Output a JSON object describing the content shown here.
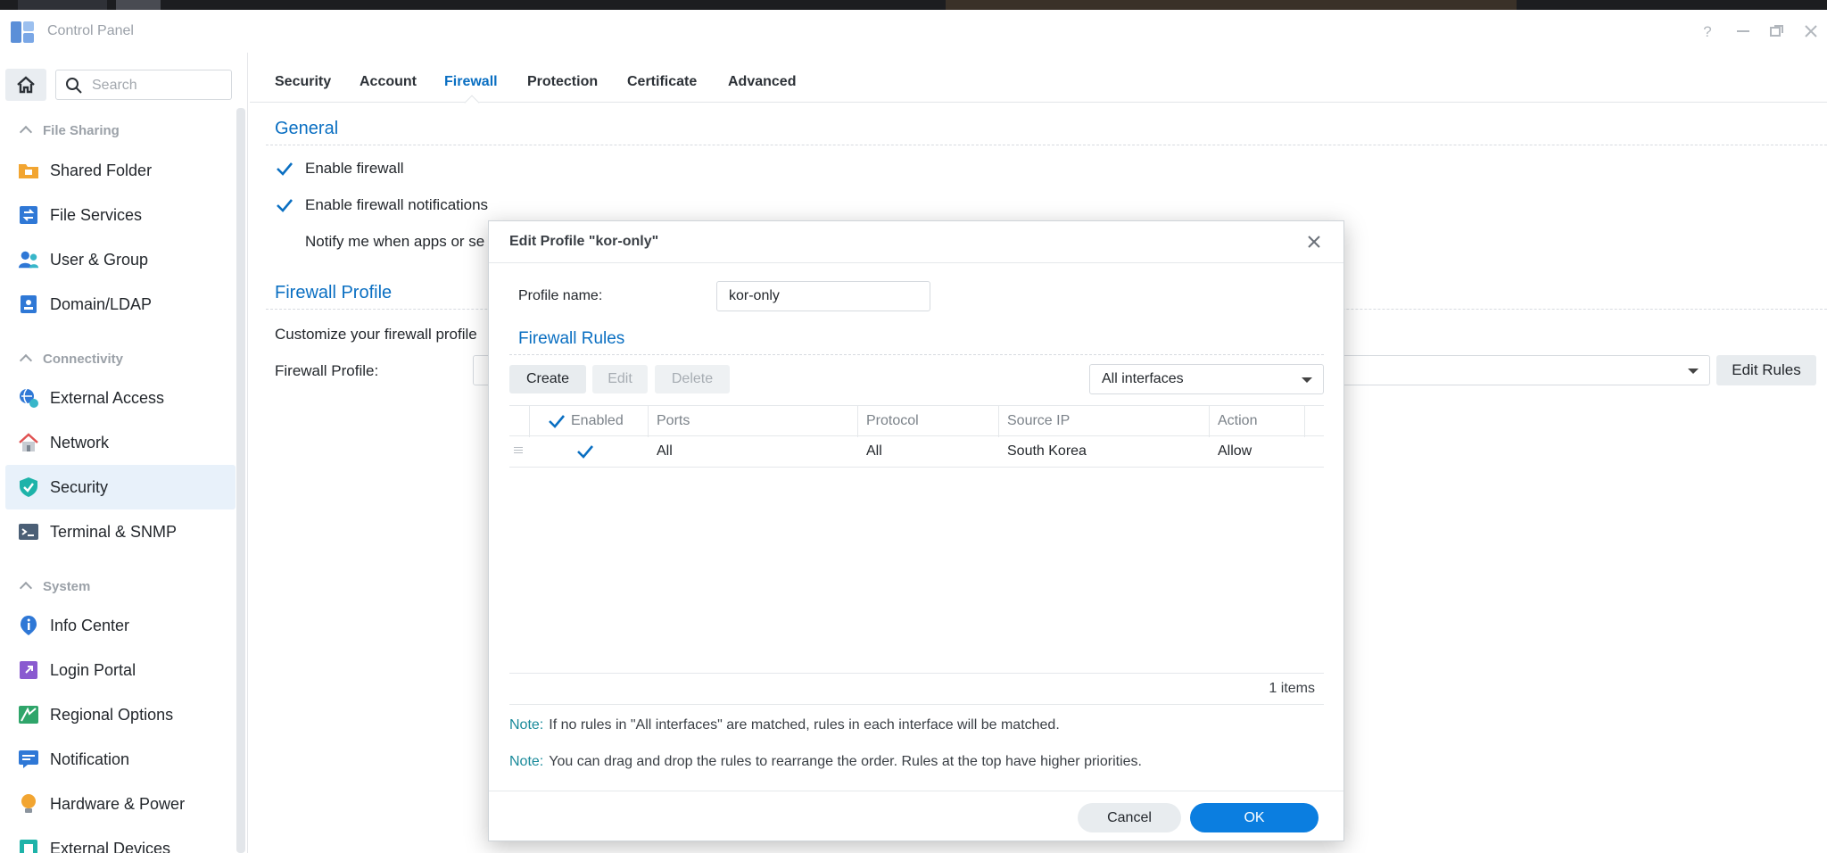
{
  "window": {
    "title": "Control Panel"
  },
  "sidebar": {
    "search_placeholder": "Search",
    "sections": [
      {
        "label": "File Sharing"
      },
      {
        "label": "Connectivity"
      },
      {
        "label": "System"
      }
    ],
    "items": [
      {
        "label": "Shared Folder",
        "icon": "shared-folder-icon"
      },
      {
        "label": "File Services",
        "icon": "file-services-icon"
      },
      {
        "label": "User & Group",
        "icon": "user-group-icon"
      },
      {
        "label": "Domain/LDAP",
        "icon": "domain-ldap-icon"
      },
      {
        "label": "External Access",
        "icon": "external-access-icon"
      },
      {
        "label": "Network",
        "icon": "network-icon"
      },
      {
        "label": "Security",
        "icon": "security-icon",
        "active": true
      },
      {
        "label": "Terminal & SNMP",
        "icon": "terminal-icon"
      },
      {
        "label": "Info Center",
        "icon": "info-center-icon"
      },
      {
        "label": "Login Portal",
        "icon": "login-portal-icon"
      },
      {
        "label": "Regional Options",
        "icon": "regional-options-icon"
      },
      {
        "label": "Notification",
        "icon": "notification-icon"
      },
      {
        "label": "Hardware & Power",
        "icon": "hardware-power-icon"
      },
      {
        "label": "External Devices",
        "icon": "external-devices-icon"
      }
    ]
  },
  "tabs": [
    {
      "label": "Security"
    },
    {
      "label": "Account"
    },
    {
      "label": "Firewall",
      "active": true
    },
    {
      "label": "Protection"
    },
    {
      "label": "Certificate"
    },
    {
      "label": "Advanced"
    }
  ],
  "general": {
    "title": "General",
    "enable_firewall": "Enable firewall",
    "enable_notifications": "Enable firewall notifications",
    "notify_text": "Notify me when apps or se"
  },
  "firewall_profile": {
    "title": "Firewall Profile",
    "description": "Customize your firewall profile",
    "label": "Firewall Profile:",
    "edit_rules": "Edit Rules"
  },
  "dialog": {
    "title": "Edit Profile \"kor-only\"",
    "profile_name_label": "Profile name:",
    "profile_name_value": "kor-only",
    "rules_title": "Firewall Rules",
    "buttons": {
      "create": "Create",
      "edit": "Edit",
      "delete": "Delete"
    },
    "interface_select": "All interfaces",
    "columns": {
      "enabled": "Enabled",
      "ports": "Ports",
      "protocol": "Protocol",
      "source_ip": "Source IP",
      "action": "Action"
    },
    "rows": [
      {
        "enabled": true,
        "ports": "All",
        "protocol": "All",
        "source_ip": "South Korea",
        "action": "Allow"
      }
    ],
    "count": "1 items",
    "notes": [
      {
        "key": "Note:",
        "text": "If no rules in \"All interfaces\" are matched, rules in each interface will be matched."
      },
      {
        "key": "Note:",
        "text": "You can drag and drop the rules to rearrange the order. Rules at the top have higher priorities."
      }
    ],
    "cancel": "Cancel",
    "ok": "OK"
  },
  "colors": {
    "accent": "#0a6fc2",
    "ok_button": "#0b7ee0",
    "note_key": "#1a8a9a"
  }
}
